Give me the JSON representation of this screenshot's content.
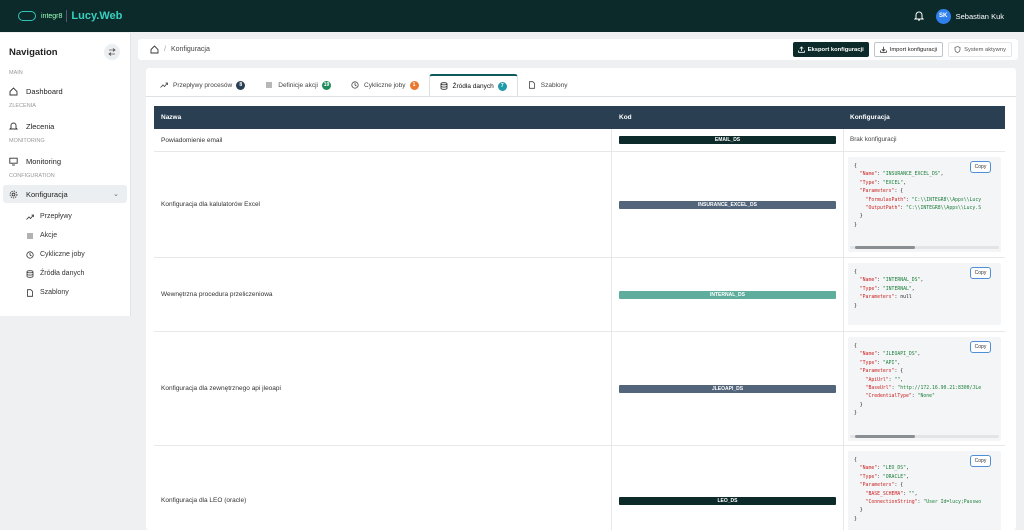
{
  "app": {
    "brand": "integr8",
    "name": "Lucy.Web",
    "user_initials": "SK",
    "user_name": "Sebastian Kuk"
  },
  "sidebar": {
    "title": "Navigation",
    "sections": {
      "main": "MAIN",
      "zlecenia": "ZLECENIA",
      "monitoring": "MONITORING",
      "configuration": "CONFIGURATION"
    },
    "items": {
      "dashboard": "Dashboard",
      "zlecenia": "Zlecenia",
      "monitoring": "Monitoring",
      "konfiguracja": "Konfiguracja"
    },
    "sub": [
      "Przepływy",
      "Akcje",
      "Cykliczne joby",
      "Źródła danych",
      "Szablony"
    ]
  },
  "breadcrumb": {
    "page": "Konfiguracja"
  },
  "toolbar": {
    "export": "Eksport konfiguracji",
    "import": "Import konfiguracji",
    "status": "System aktywny"
  },
  "tabs": [
    {
      "label": "Przepływy procesów",
      "count": "8",
      "color": "#2a3f52"
    },
    {
      "label": "Definicje akcji",
      "count": "19",
      "color": "#1f8a5a"
    },
    {
      "label": "Cykliczne joby",
      "count": "1",
      "color": "#e8792e"
    },
    {
      "label": "Źródła danych",
      "count": "7",
      "color": "#1f9aa8"
    },
    {
      "label": "Szablony",
      "count": "",
      "color": ""
    }
  ],
  "table": {
    "headers": [
      "Nazwa",
      "Kod",
      "Konfiguracja"
    ],
    "copy_label": "Copy",
    "rows": [
      {
        "name": "Powiadomienie email",
        "code": "EMAIL_DS",
        "code_color": "#0d2a2a",
        "config": "Brak konfiguracji"
      },
      {
        "name": "Konfiguracja dla kalulatorów Excel",
        "code": "INSURANCE_EXCEL_DS",
        "code_color": "#52657a",
        "config": ""
      },
      {
        "name": "Wewnętrzna procedura przeliczeniowa",
        "code": "INTERNAL_DS",
        "code_color": "#5fae9d",
        "config": ""
      },
      {
        "name": "Konfiguracja dla zewnętrznego api jleoapi",
        "code": "JLEOAPI_DS",
        "code_color": "#52657a",
        "config": ""
      },
      {
        "name": "Konfiguracja dla LEO (oracle)",
        "code": "LEO_DS",
        "code_color": "#0d2a2a",
        "config": ""
      }
    ],
    "json_lines": [
      [
        "{",
        "  \"Name\": \"INSURANCE_EXCEL_DS\",",
        "  \"Type\": \"EXCEL\",",
        "  \"Parameters\": {",
        "    \"FormulasPath\": \"C:\\\\INTEGR8\\\\Apps\\\\Lucy",
        "    \"OutputPath\": \"C:\\\\INTEGR8\\\\Apps\\\\Lucy.S",
        "  }",
        "}"
      ],
      [
        "{",
        "  \"Name\": \"INTERNAL_DS\",",
        "  \"Type\": \"INTERNAL\",",
        "  \"Parameters\": null",
        "}"
      ],
      [
        "{",
        "  \"Name\": \"JLEOAPI_DS\",",
        "  \"Type\": \"API\",",
        "  \"Parameters\": {",
        "    \"ApiUrl\": \"\",",
        "    \"BaseUrl\": \"http://172.16.90.21:8300/JLe",
        "    \"CredentialType\": \"None\"",
        "  }",
        "}"
      ],
      [
        "{",
        "  \"Name\": \"LEO_DS\",",
        "  \"Type\": \"ORACLE\",",
        "  \"Parameters\": {",
        "    \"BASE_SCHEMA\": \"\",",
        "    \"ConnectionString\": \"User Id=lucy;Passwo",
        "  }",
        "}"
      ]
    ]
  }
}
